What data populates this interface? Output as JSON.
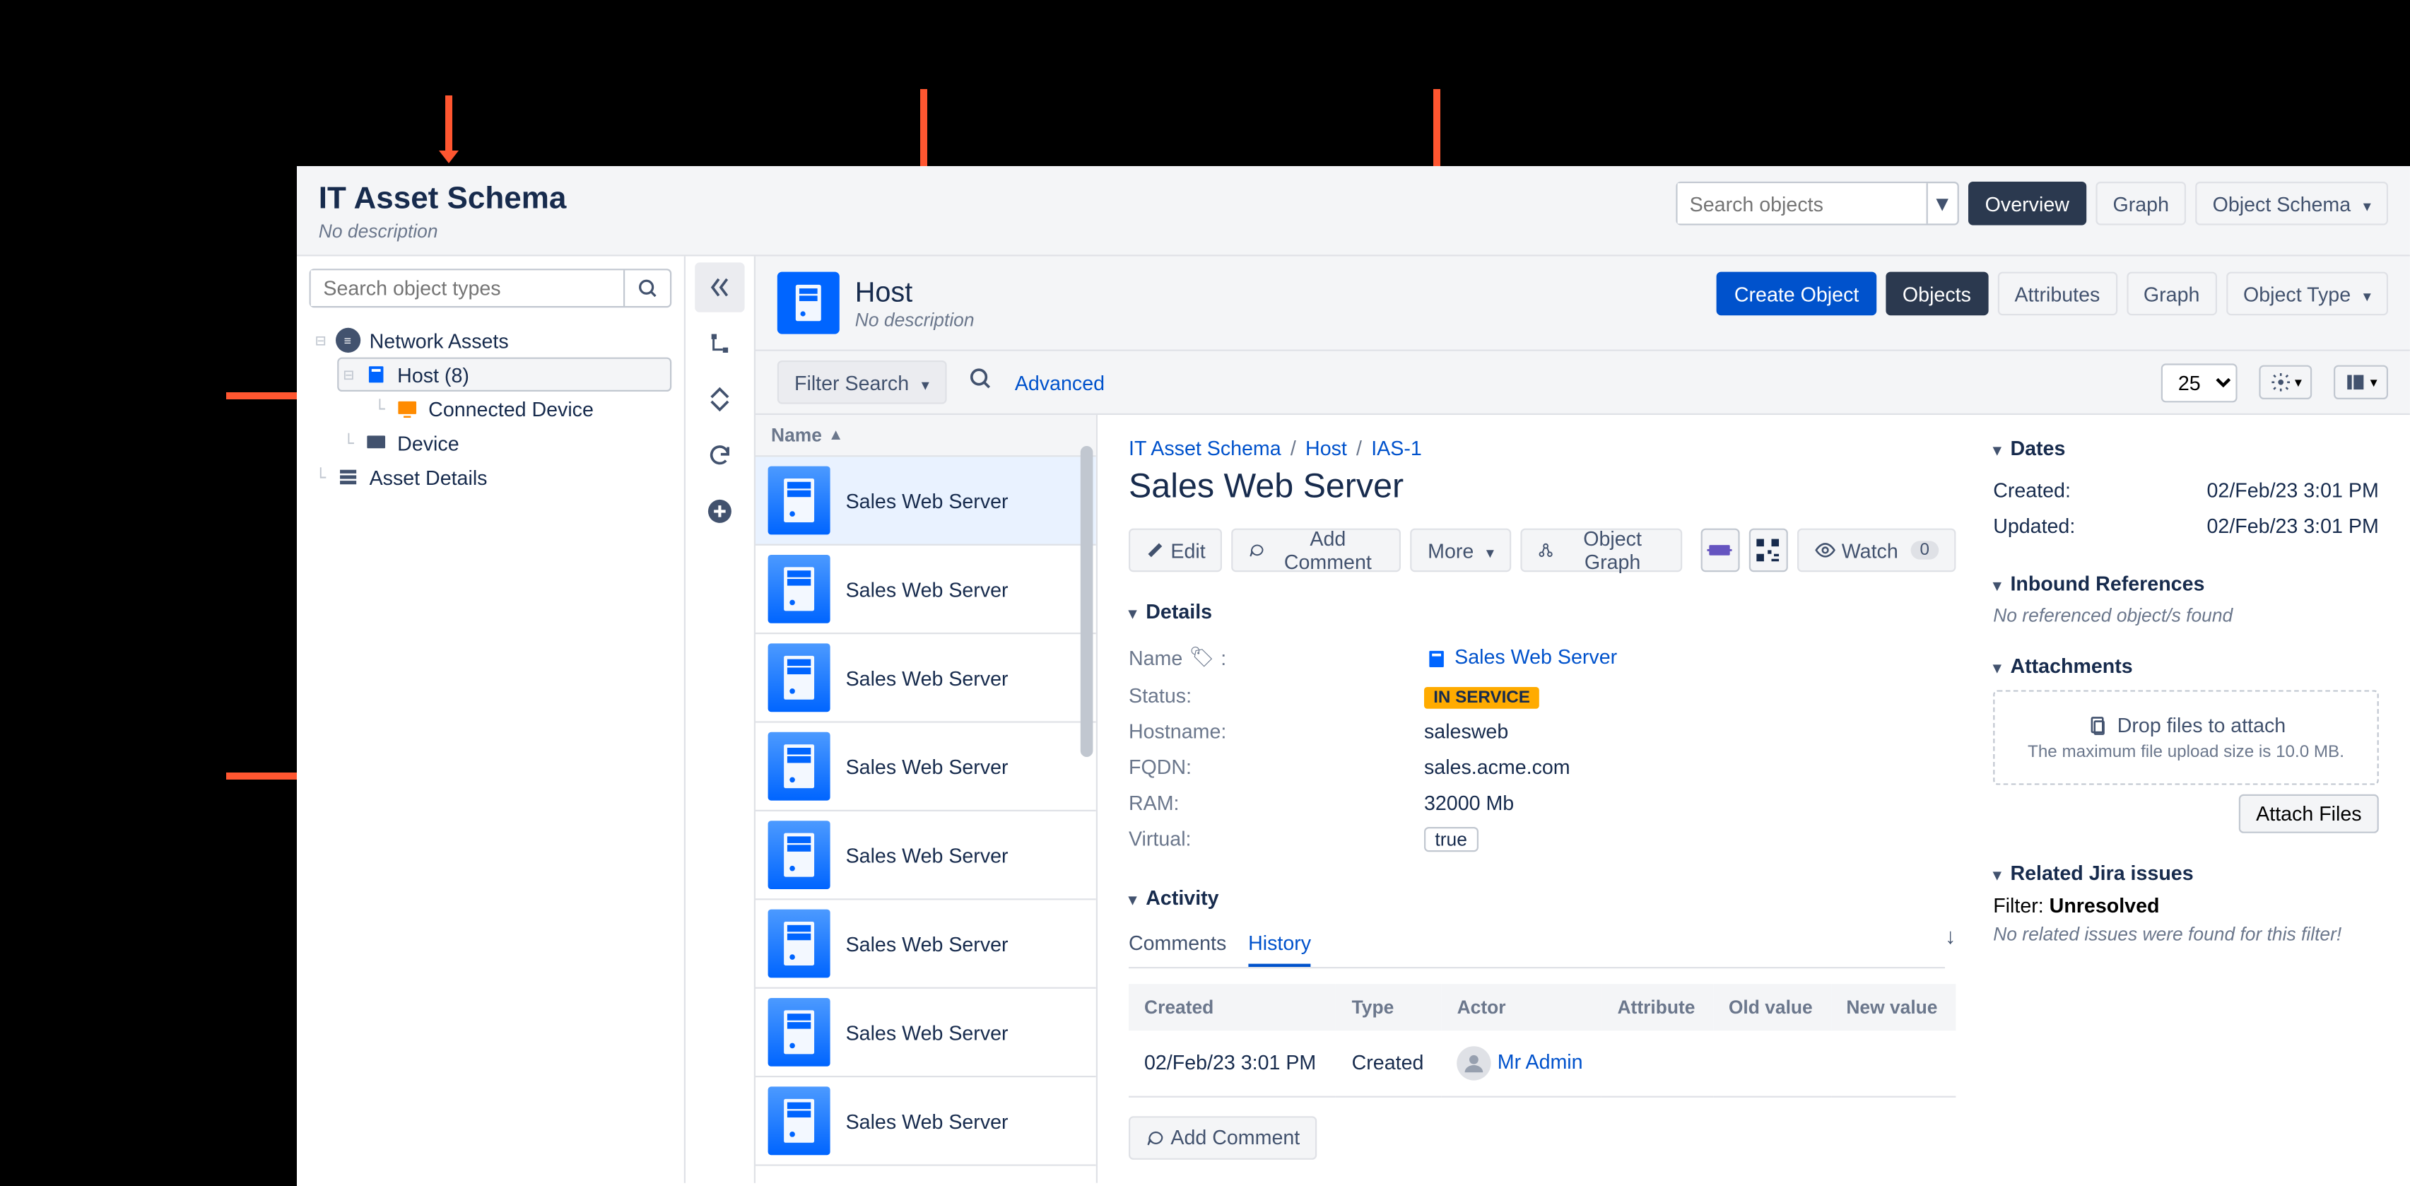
{
  "header": {
    "title": "IT Asset Schema",
    "description": "No description",
    "search_placeholder": "Search objects",
    "overview_btn": "Overview",
    "graph_btn": "Graph",
    "object_schema_btn": "Object Schema"
  },
  "sidebar": {
    "search_placeholder": "Search object types",
    "tree": {
      "root": "Network Assets",
      "host": "Host (8)",
      "connected": "Connected Device",
      "device": "Device",
      "asset_details": "Asset Details"
    }
  },
  "content_header": {
    "title": "Host",
    "description": "No description",
    "create_btn": "Create Object",
    "objects_btn": "Objects",
    "attributes_btn": "Attributes",
    "graph_btn": "Graph",
    "object_type_btn": "Object Type"
  },
  "filter": {
    "filter_search": "Filter Search",
    "advanced": "Advanced",
    "page_size": "25"
  },
  "object_list": {
    "column": "Name",
    "items": [
      "Sales Web Server",
      "Sales Web Server",
      "Sales Web Server",
      "Sales Web Server",
      "Sales Web Server",
      "Sales Web Server",
      "Sales Web Server",
      "Sales Web Server"
    ]
  },
  "breadcrumb": {
    "schema": "IT Asset Schema",
    "type": "Host",
    "id": "IAS-1"
  },
  "object": {
    "title": "Sales Web Server",
    "edit": "Edit",
    "add_comment": "Add Comment",
    "more": "More",
    "graph": "Object Graph",
    "watch": "Watch",
    "watch_count": "0"
  },
  "details": {
    "heading": "Details",
    "rows": {
      "name_key": "Name",
      "name_val": "Sales Web Server",
      "status_key": "Status:",
      "status_val": "IN SERVICE",
      "hostname_key": "Hostname:",
      "hostname_val": "salesweb",
      "fqdn_key": "FQDN:",
      "fqdn_val": "sales.acme.com",
      "ram_key": "RAM:",
      "ram_val": "32000 Mb",
      "virtual_key": "Virtual:",
      "virtual_val": "true"
    }
  },
  "activity": {
    "heading": "Activity",
    "tab_comments": "Comments",
    "tab_history": "History",
    "col_created": "Created",
    "col_type": "Type",
    "col_actor": "Actor",
    "col_attribute": "Attribute",
    "col_old": "Old value",
    "col_new": "New value",
    "row": {
      "created": "02/Feb/23 3:01 PM",
      "type": "Created",
      "actor": "Mr Admin"
    },
    "add_comment_btn": "Add Comment"
  },
  "side": {
    "dates_heading": "Dates",
    "created_k": "Created:",
    "created_v": "02/Feb/23 3:01 PM",
    "updated_k": "Updated:",
    "updated_v": "02/Feb/23 3:01 PM",
    "inbound_heading": "Inbound References",
    "inbound_empty": "No referenced object/s found",
    "attach_heading": "Attachments",
    "drop_text": "Drop files to attach",
    "drop_sub": "The maximum file upload size is 10.0 MB.",
    "attach_btn": "Attach Files",
    "jira_heading": "Related Jira issues",
    "filter_label": "Filter:",
    "filter_val": "Unresolved",
    "jira_empty": "No related issues were found for this filter!"
  }
}
